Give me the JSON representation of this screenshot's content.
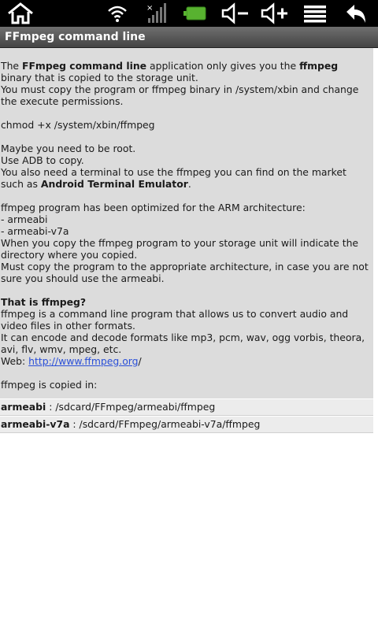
{
  "statusbar": {
    "icons": [
      "home-icon",
      "wifi-icon",
      "signal-icon",
      "battery-icon",
      "volume-down-icon",
      "volume-up-icon",
      "menu-icon",
      "back-icon"
    ],
    "battery_color": "#58b230"
  },
  "titlebar": {
    "title": "FFmpeg command line"
  },
  "content": {
    "p1": {
      "a": "The ",
      "b": "FFmpeg command line",
      "c": " application only gives you the ",
      "d": "ffmpeg",
      "e": " binary that is copied to the storage unit.",
      "f": "You must copy the program or ffmpeg binary in /system/xbin and change the execute permissions."
    },
    "p2": "chmod +x /system/xbin/ffmpeg",
    "p3": {
      "l1": "Maybe you need to be root.",
      "l2": "Use ADB to copy.",
      "l3": "You also need a terminal to use the ffmpeg you can find on the market such as ",
      "l3b": "Android Terminal Emulator",
      "l3c": "."
    },
    "p4": {
      "l1": "ffmpeg program has been optimized for the ARM architecture:",
      "l2": "- armeabi",
      "l3": "- armeabi-v7a",
      "l4": "When you copy the ffmpeg program to your storage unit will indicate the directory where you copied.",
      "l5": "Must copy the program to the appropriate architecture, in case you are not sure you should use the armeabi."
    },
    "p5": {
      "heading": "That is ffmpeg?",
      "l1": "ffmpeg is a command line program that allows us to convert audio and video files in other formats.",
      "l2": "It can encode and decode formats like mp3, pcm, wav, ogg vorbis, theora, avi, flv, wmv, mpeg, etc.",
      "web_label": "Web: ",
      "web_link": "http://www.ffmpeg.org",
      "web_after": "/"
    },
    "p6": "ffmpeg is copied in:"
  },
  "rows": [
    {
      "key": "armeabi",
      "sep": " : ",
      "path": "/sdcard/FFmpeg/armeabi/ffmpeg"
    },
    {
      "key": "armeabi-v7a",
      "sep": " : ",
      "path": "/sdcard/FFmpeg/armeabi-v7a/ffmpeg"
    }
  ]
}
